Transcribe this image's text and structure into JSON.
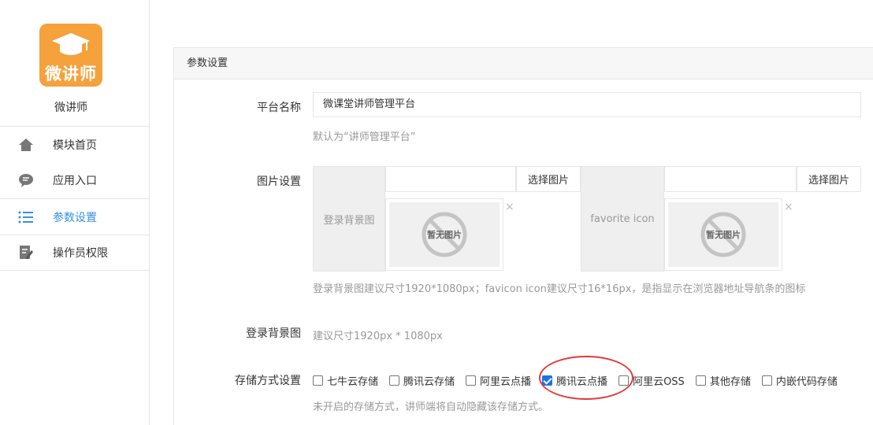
{
  "sidebar": {
    "logo_text": "微讲师",
    "app_name": "微讲师",
    "items": [
      {
        "label": "模块首页",
        "icon": "home-icon"
      },
      {
        "label": "应用入口",
        "icon": "chat-bubble-icon"
      },
      {
        "label": "参数设置",
        "icon": "list-icon",
        "active": true
      },
      {
        "label": "操作员权限",
        "icon": "edit-document-icon"
      }
    ]
  },
  "panel": {
    "title": "参数设置",
    "platform_name": {
      "label": "平台名称",
      "value": "微课堂讲师管理平台",
      "hint": "默认为“讲师管理平台”"
    },
    "image_settings": {
      "label": "图片设置",
      "groups": [
        {
          "name": "登录背景图",
          "button": "选择图片",
          "placeholder": "暂无图片",
          "close": "×"
        },
        {
          "name": "favorite icon",
          "button": "选择图片",
          "placeholder": "暂无图片",
          "close": "×"
        }
      ],
      "hint": "登录背景图建议尺寸1920*1080px；favicon icon建议尺寸16*16px，是指显示在浏览器地址导航条的图标"
    },
    "login_bg": {
      "label": "登录背景图",
      "hint": "建议尺寸1920px * 1080px"
    },
    "storage": {
      "label": "存储方式设置",
      "options": [
        {
          "label": "七牛云存储",
          "checked": false
        },
        {
          "label": "腾讯云存储",
          "checked": false
        },
        {
          "label": "阿里云点播",
          "checked": false
        },
        {
          "label": "腾讯云点播",
          "checked": true
        },
        {
          "label": "阿里云OSS",
          "checked": false
        },
        {
          "label": "其他存储",
          "checked": false
        },
        {
          "label": "内嵌代码存储",
          "checked": false
        }
      ],
      "hint": "未开启的存储方式，讲师端将自动隐藏该存储方式。"
    }
  },
  "colors": {
    "accent": "#3a8ee6",
    "logo_bg": "#f5a13c",
    "annotation_ring": "#e23a3a"
  }
}
